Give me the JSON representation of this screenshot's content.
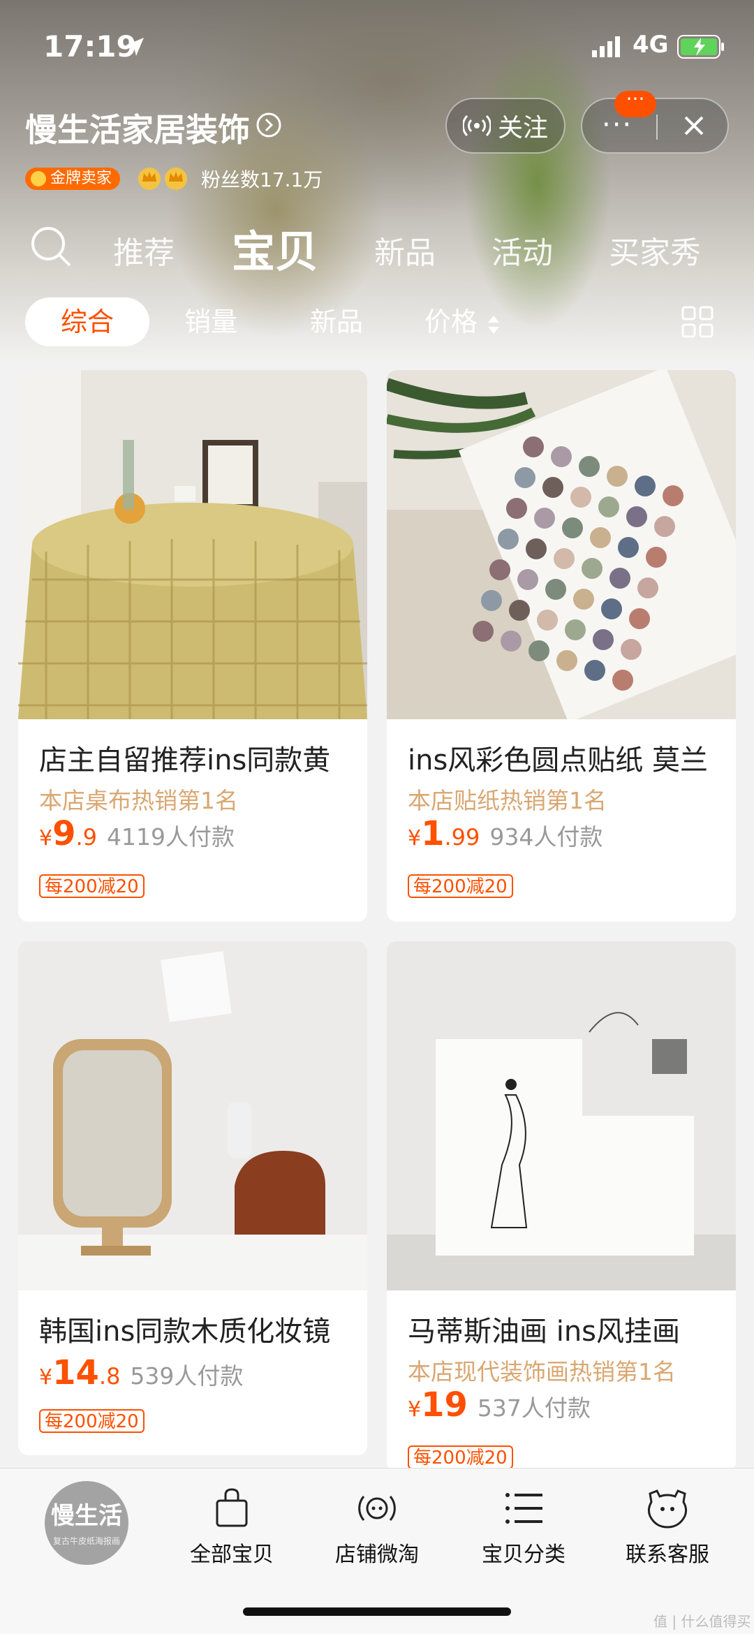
{
  "status_bar": {
    "time": "17:19",
    "network": "4G"
  },
  "shop": {
    "name": "慢生活家居装饰",
    "badge": "金牌卖家",
    "fans": "粉丝数17.1万",
    "follow_label": "关注",
    "more_label": "···",
    "notification": "···"
  },
  "tabs": [
    {
      "label": "推荐"
    },
    {
      "label": "宝贝"
    },
    {
      "label": "新品"
    },
    {
      "label": "活动"
    },
    {
      "label": "买家秀"
    }
  ],
  "filters": [
    {
      "label": "综合"
    },
    {
      "label": "销量"
    },
    {
      "label": "新品"
    },
    {
      "label": "价格"
    }
  ],
  "products": [
    {
      "title": "店主自留推荐ins同款黄",
      "rank": "本店桌布热销第1名",
      "price_symbol": "¥",
      "price_int": "9",
      "price_dec": ".9",
      "sold": "4119人付款",
      "coupon": "每200减20"
    },
    {
      "title": "ins风彩色圆点贴纸 莫兰",
      "rank": "本店贴纸热销第1名",
      "price_symbol": "¥",
      "price_int": "1",
      "price_dec": ".99",
      "sold": "934人付款",
      "coupon": "每200减20"
    },
    {
      "title": "韩国ins同款木质化妆镜",
      "rank": "",
      "price_symbol": "¥",
      "price_int": "14",
      "price_dec": ".8",
      "sold": "539人付款",
      "coupon": "每200减20"
    },
    {
      "title": "马蒂斯油画 ins风挂画",
      "rank": "本店现代装饰画热销第1名",
      "price_symbol": "¥",
      "price_int": "19",
      "price_dec": "",
      "sold": "537人付款",
      "coupon": "每200减20"
    }
  ],
  "bottom_nav": {
    "logo_text": "慢生活",
    "logo_sub": "复古牛皮纸海报画",
    "items": [
      {
        "label": "全部宝贝",
        "icon": "bag-icon"
      },
      {
        "label": "店铺微淘",
        "icon": "broadcast-icon"
      },
      {
        "label": "宝贝分类",
        "icon": "list-icon"
      },
      {
        "label": "联系客服",
        "icon": "chat-face-icon"
      }
    ]
  },
  "watermark": "值 | 什么值得买",
  "colors": {
    "accent": "#ff5000",
    "rank": "#d9a772",
    "gold_badge": "#ff6a00"
  }
}
